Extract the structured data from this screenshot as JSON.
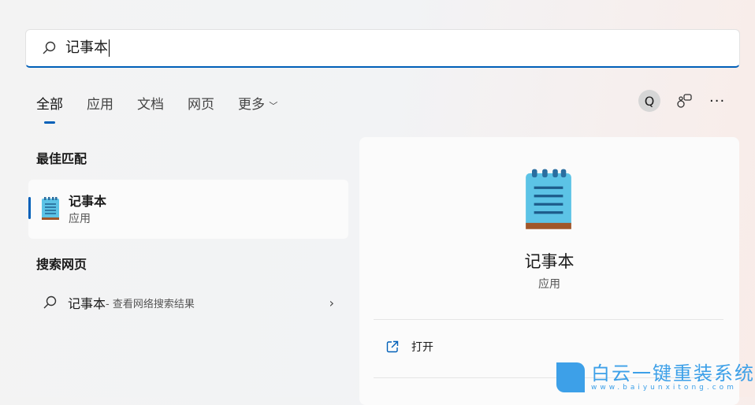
{
  "search": {
    "value": "记事本"
  },
  "tabs": [
    {
      "label": "全部"
    },
    {
      "label": "应用"
    },
    {
      "label": "文档"
    },
    {
      "label": "网页"
    },
    {
      "label": "更多"
    }
  ],
  "toolbar": {
    "account_initial": "Q"
  },
  "best_match": {
    "heading": "最佳匹配",
    "title": "记事本",
    "subtitle": "应用"
  },
  "web_search": {
    "heading": "搜索网页",
    "query": "记事本",
    "suffix": " - 查看网络搜索结果"
  },
  "detail": {
    "title": "记事本",
    "subtitle": "应用",
    "actions": [
      {
        "label": "打开"
      }
    ]
  },
  "watermark": {
    "title": "白云一键重装系统",
    "url": "www.baiyunxitong.com"
  },
  "colors": {
    "accent": "#005fb8"
  }
}
